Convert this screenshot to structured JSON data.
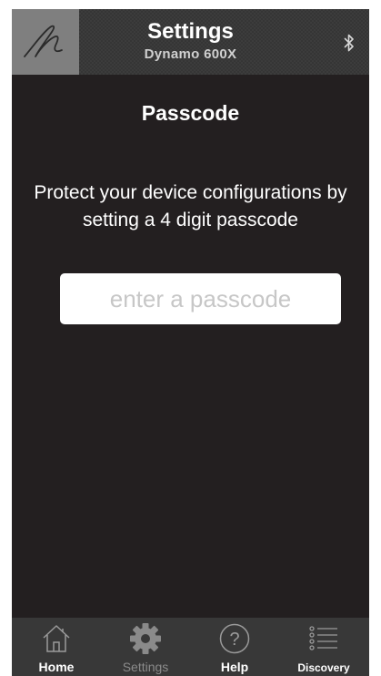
{
  "header": {
    "title": "Settings",
    "subtitle": "Dynamo 600X",
    "logo_icon": "signature-logo-icon",
    "bluetooth_icon": "bluetooth-icon"
  },
  "main": {
    "page_title": "Passcode",
    "description": "Protect your device configurations by setting a 4 digit passcode",
    "passcode_input": {
      "value": "",
      "placeholder": "enter a passcode"
    }
  },
  "tabbar": {
    "tabs": [
      {
        "label": "Home",
        "icon": "home-icon",
        "active": true
      },
      {
        "label": "Settings",
        "icon": "gear-icon",
        "active": false
      },
      {
        "label": "Help",
        "icon": "help-icon",
        "active": true
      },
      {
        "label": "Discovery",
        "icon": "list-icon",
        "active": true
      }
    ]
  },
  "colors": {
    "background": "#231f20",
    "header": "#353535",
    "logo_box": "#7f7f7f",
    "tabbar": "#383838",
    "inactive_tab": "#8a8a8a"
  }
}
